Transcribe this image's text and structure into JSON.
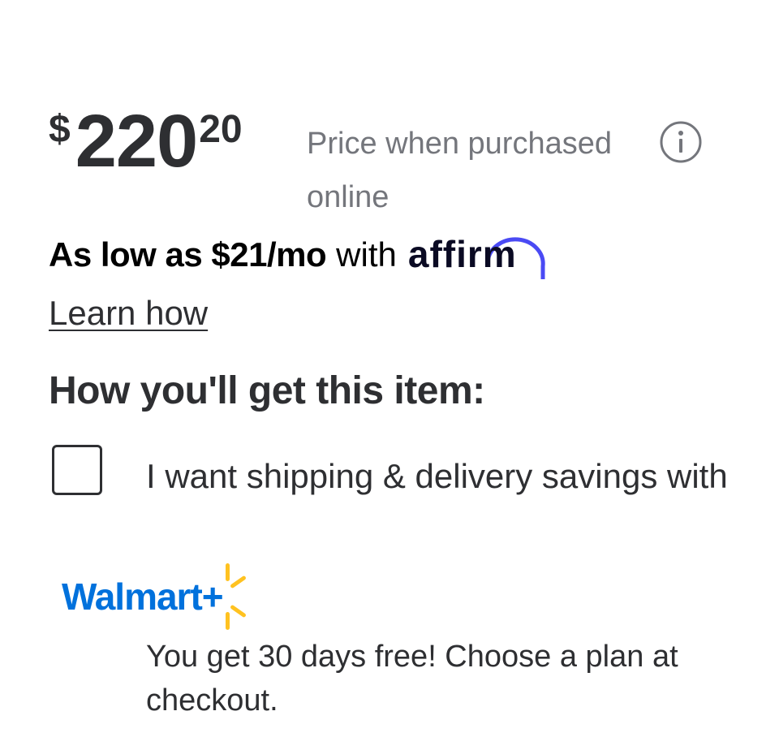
{
  "price": {
    "currency": "$",
    "dollars": "220",
    "cents": "20",
    "note": "Price when purchased online"
  },
  "info_icon": "info-circle-icon",
  "affirm": {
    "bold_text": "As low as $21/mo",
    "with_text": "with",
    "logo_text": "affirm",
    "logo_arc_color": "#4a4af4"
  },
  "learn_how": "Learn how",
  "fulfillment": {
    "heading": "How you'll get this item:",
    "checkbox_checked": false,
    "checkbox_label": "I want shipping & delivery savings with",
    "walmart_plus": {
      "text": "Walmart+",
      "brand_color": "#0071dc",
      "spark_color": "#ffc220"
    },
    "promo": "You get 30 days free! Choose a plan at checkout."
  }
}
